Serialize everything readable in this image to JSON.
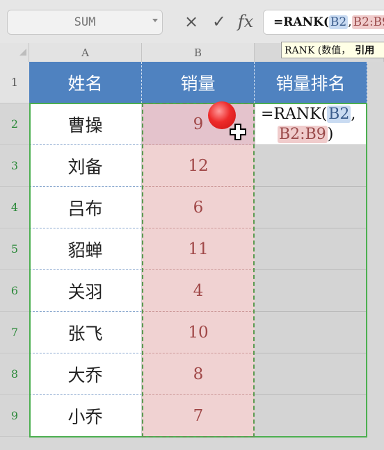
{
  "namebox": {
    "value": "SUM"
  },
  "formula_bar": {
    "cancel_glyph": "×",
    "confirm_glyph": "✓",
    "fx_glyph": "fx",
    "text_prefix": "=RANK(",
    "ref1": "B2",
    "sep": ",",
    "ref2": "B2:B9"
  },
  "tooltip": {
    "text": "RANK (数值，",
    "bold": "引用"
  },
  "columns": [
    "A",
    "B"
  ],
  "rows": [
    "1",
    "2",
    "3",
    "4",
    "5",
    "6",
    "7",
    "8",
    "9"
  ],
  "table": {
    "headers": [
      "姓名",
      "销量",
      "销量排名"
    ],
    "names": [
      "曹操",
      "刘备",
      "吕布",
      "貂蝉",
      "关羽",
      "张飞",
      "大乔",
      "小乔"
    ],
    "sales": [
      "9",
      "12",
      "6",
      "11",
      "4",
      "10",
      "8",
      "7"
    ]
  },
  "edit_cell": {
    "line1_prefix": "=RANK(",
    "ref1": "B2",
    "sep": ",",
    "ref2": "B2:B9",
    "close": ")"
  },
  "colors": {
    "header_bg": "#4f82c0",
    "sales_bg": "#f0d2d2",
    "selection_green": "#4caf50"
  }
}
